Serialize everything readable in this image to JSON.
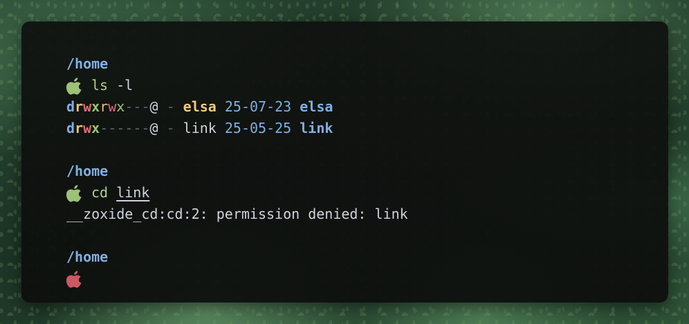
{
  "colors": {
    "path": "#82aee0",
    "prompt_ok": "#9dc07a",
    "prompt_err": "#c85a64",
    "command": "#b3d18f",
    "text": "#cfd3dc"
  },
  "blocks": [
    {
      "cwd": "/home",
      "prompt_icon": "apple-icon",
      "command": "ls",
      "args": "-l",
      "output": [
        {
          "perms": [
            "d",
            "r",
            "w",
            "x",
            "r",
            "w",
            "x",
            "-",
            "-",
            "-"
          ],
          "at": "@",
          "dash": "-",
          "user": "elsa",
          "date": "25-07-23",
          "name": "elsa"
        },
        {
          "perms": [
            "d",
            "r",
            "w",
            "x",
            "-",
            "-",
            "-",
            "-",
            "-",
            "-"
          ],
          "at": "@",
          "dash": "-",
          "user": "link",
          "date": "25-05-25",
          "name": "link"
        }
      ]
    },
    {
      "cwd": "/home",
      "prompt_icon": "apple-icon",
      "command": "cd",
      "args": "link",
      "error": "__zoxide_cd:cd:2: permission denied: link"
    },
    {
      "cwd": "/home",
      "prompt_icon": "apple-icon"
    }
  ]
}
